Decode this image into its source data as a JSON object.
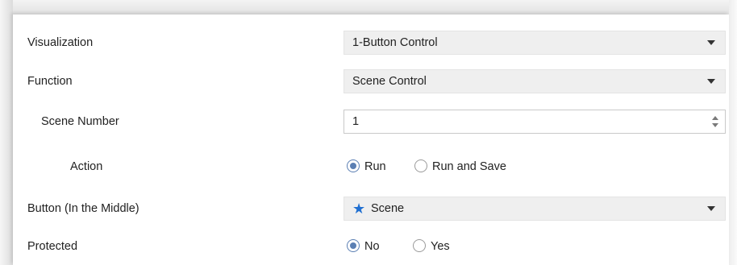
{
  "rows": {
    "visualization": {
      "label": "Visualization",
      "value": "1-Button Control"
    },
    "function": {
      "label": "Function",
      "value": "Scene Control"
    },
    "scene_number": {
      "label": "Scene Number",
      "value": "1"
    },
    "action": {
      "label": "Action",
      "options": [
        "Run",
        "Run and Save"
      ],
      "selected": "Run"
    },
    "button": {
      "label": "Button (In the Middle)",
      "value": "Scene",
      "icon": "star-icon"
    },
    "protected": {
      "label": "Protected",
      "options": [
        "No",
        "Yes"
      ],
      "selected": "No"
    }
  },
  "colors": {
    "accent": "#5b7fb3",
    "star": "#1f6fd1",
    "select_bg": "#efefef"
  }
}
